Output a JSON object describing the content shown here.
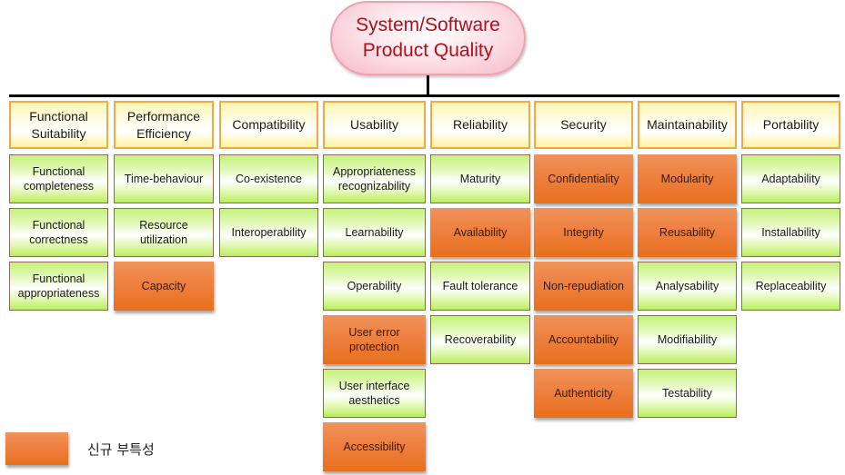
{
  "title": {
    "line1": "System/Software",
    "line2": "Product Quality"
  },
  "colors": {
    "new_characteristic": "#ee8040",
    "existing_characteristic": "#c6f27a",
    "header_border": "#f5a842",
    "title_text": "#b0101a"
  },
  "categories": [
    {
      "name": "Functional Suitability",
      "items": [
        {
          "label": "Functional completeness",
          "new": false
        },
        {
          "label": "Functional correctness",
          "new": false
        },
        {
          "label": "Functional appropriateness",
          "new": false
        }
      ]
    },
    {
      "name": "Performance Efficiency",
      "items": [
        {
          "label": "Time-behaviour",
          "new": false
        },
        {
          "label": "Resource utilization",
          "new": false
        },
        {
          "label": "Capacity",
          "new": true
        }
      ]
    },
    {
      "name": "Compatibility",
      "items": [
        {
          "label": "Co-existence",
          "new": false
        },
        {
          "label": "Interoperability",
          "new": false
        }
      ]
    },
    {
      "name": "Usability",
      "items": [
        {
          "label": "Appropriateness recognizability",
          "new": false
        },
        {
          "label": "Learnability",
          "new": false
        },
        {
          "label": "Operability",
          "new": false
        },
        {
          "label": "User error protection",
          "new": true
        },
        {
          "label": "User interface aesthetics",
          "new": false
        },
        {
          "label": "Accessibility",
          "new": true
        }
      ]
    },
    {
      "name": "Reliability",
      "items": [
        {
          "label": "Maturity",
          "new": false
        },
        {
          "label": "Availability",
          "new": true
        },
        {
          "label": "Fault tolerance",
          "new": false
        },
        {
          "label": "Recoverability",
          "new": false
        }
      ]
    },
    {
      "name": "Security",
      "items": [
        {
          "label": "Confidentiality",
          "new": true
        },
        {
          "label": "Integrity",
          "new": true
        },
        {
          "label": "Non-repudiation",
          "new": true
        },
        {
          "label": "Accountability",
          "new": true
        },
        {
          "label": "Authenticity",
          "new": true
        }
      ]
    },
    {
      "name": "Maintainability",
      "items": [
        {
          "label": "Modularity",
          "new": true
        },
        {
          "label": "Reusability",
          "new": true
        },
        {
          "label": "Analysability",
          "new": false
        },
        {
          "label": "Modifiability",
          "new": false
        },
        {
          "label": "Testability",
          "new": false
        }
      ]
    },
    {
      "name": "Portability",
      "items": [
        {
          "label": "Adaptability",
          "new": false
        },
        {
          "label": "Installability",
          "new": false
        },
        {
          "label": "Replaceability",
          "new": false
        }
      ]
    }
  ],
  "legend": {
    "label": "신규 부특성"
  }
}
